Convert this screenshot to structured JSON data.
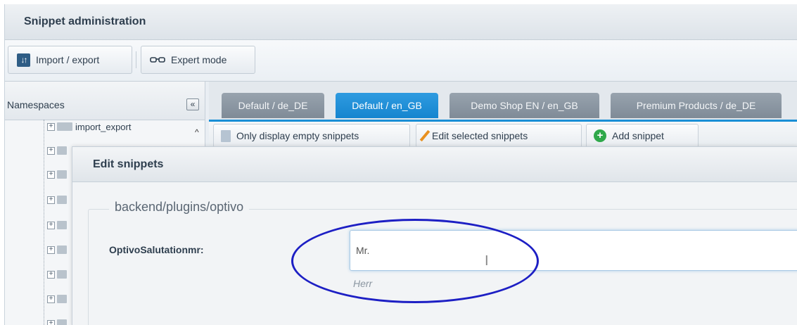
{
  "window": {
    "title": "Snippet administration"
  },
  "toolbar": {
    "import_label": "Import / export",
    "import_icon": "import-export-icon",
    "expert_label": "Expert mode",
    "expert_icon": "glasses-icon"
  },
  "sidebar": {
    "title": "Namespaces",
    "collapse_symbol": "«",
    "first_item": "import_export",
    "scroll_symbol": "^"
  },
  "tabs": [
    {
      "label": "Default / de_DE"
    },
    {
      "label": "Default / en_GB"
    },
    {
      "label": "Demo Shop EN / en_GB"
    },
    {
      "label": "Premium Products / de_DE"
    }
  ],
  "active_tab": "Default / en_GB",
  "content_toolbar": {
    "empty_label": "Only display empty snippets",
    "edit_label": "Edit selected snippets",
    "add_label": "Add snippet"
  },
  "modal": {
    "title": "Edit snippets",
    "namespace": "backend/plugins/optivo",
    "field_label": "OptivoSalutationmr:",
    "field_value": "Mr.",
    "field_hint": "Herr"
  },
  "colors": {
    "accent": "#1a8fd6",
    "tab_inactive": "#8a96a2",
    "highlight": "#1d1fc4"
  }
}
